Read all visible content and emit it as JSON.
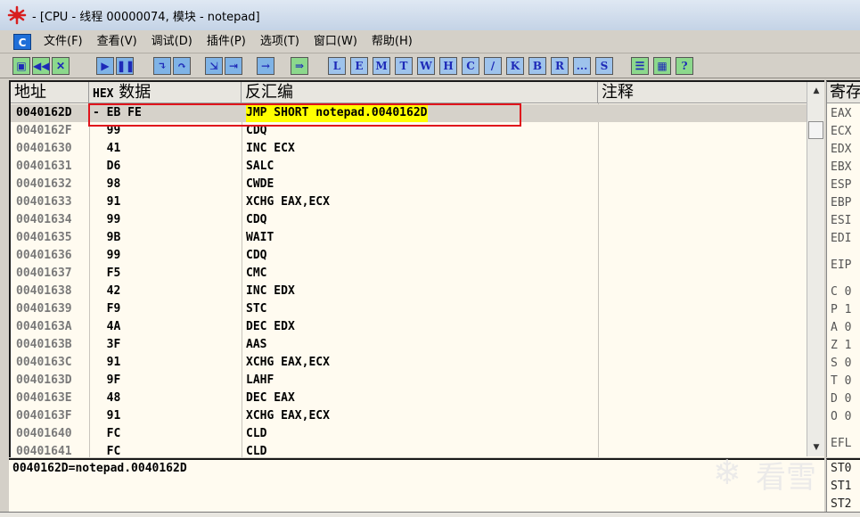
{
  "window": {
    "title": "- [CPU - 线程 00000074, 模块 - notepad]"
  },
  "menu": {
    "sys_icon": "C",
    "items": [
      "文件(F)",
      "查看(V)",
      "调试(D)",
      "插件(P)",
      "选项(T)",
      "窗口(W)",
      "帮助(H)"
    ]
  },
  "toolbar": {
    "letters": [
      "L",
      "E",
      "M",
      "T",
      "W",
      "H",
      "C",
      "/",
      "K",
      "B",
      "R",
      "...",
      "S"
    ]
  },
  "columns": {
    "address": "地址",
    "hex_prefix": "HEX",
    "hex": "数据",
    "disasm": "反汇编",
    "comment": "注释",
    "registers": "寄存"
  },
  "rows": [
    {
      "addr": "0040162D",
      "hex": "- EB FE",
      "dis": "JMP SHORT notepad.0040162D",
      "selected": true
    },
    {
      "addr": "0040162F",
      "hex": "  99",
      "dis": "CDQ"
    },
    {
      "addr": "00401630",
      "hex": "  41",
      "dis": "INC ECX"
    },
    {
      "addr": "00401631",
      "hex": "  D6",
      "dis": "SALC"
    },
    {
      "addr": "00401632",
      "hex": "  98",
      "dis": "CWDE"
    },
    {
      "addr": "00401633",
      "hex": "  91",
      "dis": "XCHG EAX,ECX"
    },
    {
      "addr": "00401634",
      "hex": "  99",
      "dis": "CDQ"
    },
    {
      "addr": "00401635",
      "hex": "  9B",
      "dis": "WAIT"
    },
    {
      "addr": "00401636",
      "hex": "  99",
      "dis": "CDQ"
    },
    {
      "addr": "00401637",
      "hex": "  F5",
      "dis": "CMC"
    },
    {
      "addr": "00401638",
      "hex": "  42",
      "dis": "INC EDX"
    },
    {
      "addr": "00401639",
      "hex": "  F9",
      "dis": "STC"
    },
    {
      "addr": "0040163A",
      "hex": "  4A",
      "dis": "DEC EDX"
    },
    {
      "addr": "0040163B",
      "hex": "  3F",
      "dis": "AAS"
    },
    {
      "addr": "0040163C",
      "hex": "  91",
      "dis": "XCHG EAX,ECX"
    },
    {
      "addr": "0040163D",
      "hex": "  9F",
      "dis": "LAHF"
    },
    {
      "addr": "0040163E",
      "hex": "  48",
      "dis": "DEC EAX"
    },
    {
      "addr": "0040163F",
      "hex": "  91",
      "dis": "XCHG EAX,ECX"
    },
    {
      "addr": "00401640",
      "hex": "  FC",
      "dis": "CLD"
    },
    {
      "addr": "00401641",
      "hex": "  FC",
      "dis": "CLD"
    }
  ],
  "registers": [
    "EAX",
    "ECX",
    "EDX",
    "EBX",
    "ESP",
    "EBP",
    "ESI",
    "EDI",
    "EIP",
    "C 0",
    "P 1",
    "A 0",
    "Z 1",
    "S 0",
    "T 0",
    "D 0",
    "O 0",
    "EFL"
  ],
  "info": {
    "line": "0040162D=notepad.0040162D"
  },
  "stack_regs": [
    "ST0",
    "ST1",
    "ST2"
  ],
  "watermark": "看雪",
  "colors": {
    "highlight": "#ffff00",
    "annotation_box": "#e0141c",
    "background": "#fffbf0"
  }
}
